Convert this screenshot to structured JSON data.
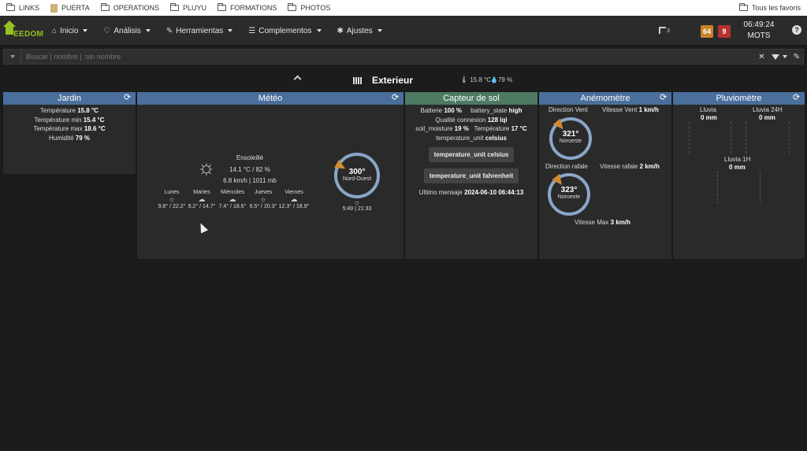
{
  "bookmarks": {
    "items": [
      "LINKS",
      "PUERTA",
      "OPERATIONS",
      "PLUYU",
      "FORMATIONS",
      "PHOTOS"
    ],
    "right": "Tous les favoris"
  },
  "navbar": {
    "logo_text": "EEDOM",
    "menu": [
      {
        "label": "Inicio",
        "icon": "home-icon"
      },
      {
        "label": "Análisis",
        "icon": "stethoscope-icon"
      },
      {
        "label": "Herramientas",
        "icon": "wrench-icon"
      },
      {
        "label": "Complementos",
        "icon": "list-icon"
      },
      {
        "label": "Ajustes",
        "icon": "gear-icon"
      }
    ],
    "flag_count": "3",
    "badge_orange": "64",
    "badge_red": "9",
    "time": "06:49:24",
    "user": "MOTS",
    "help": "?"
  },
  "search": {
    "placeholder": "Buscar | nombre | :sin nombre"
  },
  "object": {
    "title": "Exterieur",
    "temp": "15.8 °C",
    "humidity": "79 %"
  },
  "jardin": {
    "title": "Jardin",
    "rows": [
      {
        "label": "Température",
        "value": "15.8 °C"
      },
      {
        "label": "Température min",
        "value": "15.4 °C"
      },
      {
        "label": "Température max",
        "value": "18.6 °C"
      },
      {
        "label": "Humidité",
        "value": "79 %"
      }
    ]
  },
  "meteo": {
    "title": "Météo",
    "condition": "Ensoleillé",
    "temp_hum": "14.1 °C / 82 %",
    "wind_press": "6.8 km/h | 1011 mb",
    "compass_deg": "300°",
    "compass_dir": "Nord-Ouest",
    "wind_angle": 300,
    "sun_times": "5:49 | 21:33",
    "forecast": [
      {
        "day": "Lunes",
        "icon": "sun-icon",
        "range": "9.8° / 22.2°"
      },
      {
        "day": "Martes",
        "icon": "cloud-icon",
        "range": "9.2° / 14.7°"
      },
      {
        "day": "Miércoles",
        "icon": "cloud-icon",
        "range": "7.4° / 18.6°"
      },
      {
        "day": "Jueves",
        "icon": "sun-icon",
        "range": "6.5° / 20.3°"
      },
      {
        "day": "Viernes",
        "icon": "cloud-icon",
        "range": "12.3° / 18.9°"
      }
    ]
  },
  "capteur": {
    "title": "Capteur de sol",
    "rows": [
      [
        {
          "label": "Batterie",
          "value": "100 %"
        },
        {
          "label": "battery_state",
          "value": "high"
        }
      ],
      [
        {
          "label": "Qualité connexion",
          "value": "128 lqi"
        }
      ],
      [
        {
          "label": "soil_moisture",
          "value": "19 %"
        },
        {
          "label": "Température",
          "value": "17 °C"
        }
      ],
      [
        {
          "label": "temperature_unit",
          "value": "celsius"
        }
      ]
    ],
    "btn_celsius": "temperature_unit celsius",
    "btn_fahrenheit": "temperature_unit fahrenheit",
    "last_msg_label": "Ultimo mensaje",
    "last_msg_value": "2024-06-10 06:44:13"
  },
  "anemo": {
    "title": "Anémomètre",
    "dir_vent_label": "Direction Vent",
    "vit_vent_label": "Vitesse Vent",
    "vit_vent_value": "1 km/h",
    "compass1_deg": "321°",
    "compass1_dir": "Noroeste",
    "wind1_angle": 321,
    "dir_rafale_label": "Direction rafale",
    "vit_rafale_label": "Vitesse rafale",
    "vit_rafale_value": "2 km/h",
    "compass2_deg": "323°",
    "compass2_dir": "Noroeste",
    "wind2_angle": 323,
    "vit_max_label": "Vitesse Max",
    "vit_max_value": "3 km/h"
  },
  "pluvio": {
    "title": "Pluviomètre",
    "lluvia_label": "Lluvia",
    "lluvia_value": "0 mm",
    "lluvia24_label": "Lluvia 24H",
    "lluvia24_value": "0 mm",
    "lluvia1_label": "Lluvia 1H",
    "lluvia1_value": "0 mm"
  },
  "colors": {
    "header_blue": "#4a6f9c",
    "header_green": "#4c7a62",
    "accent_orange": "#d08a2e",
    "badge_orange": "#c8842a",
    "badge_red": "#b8312f"
  }
}
